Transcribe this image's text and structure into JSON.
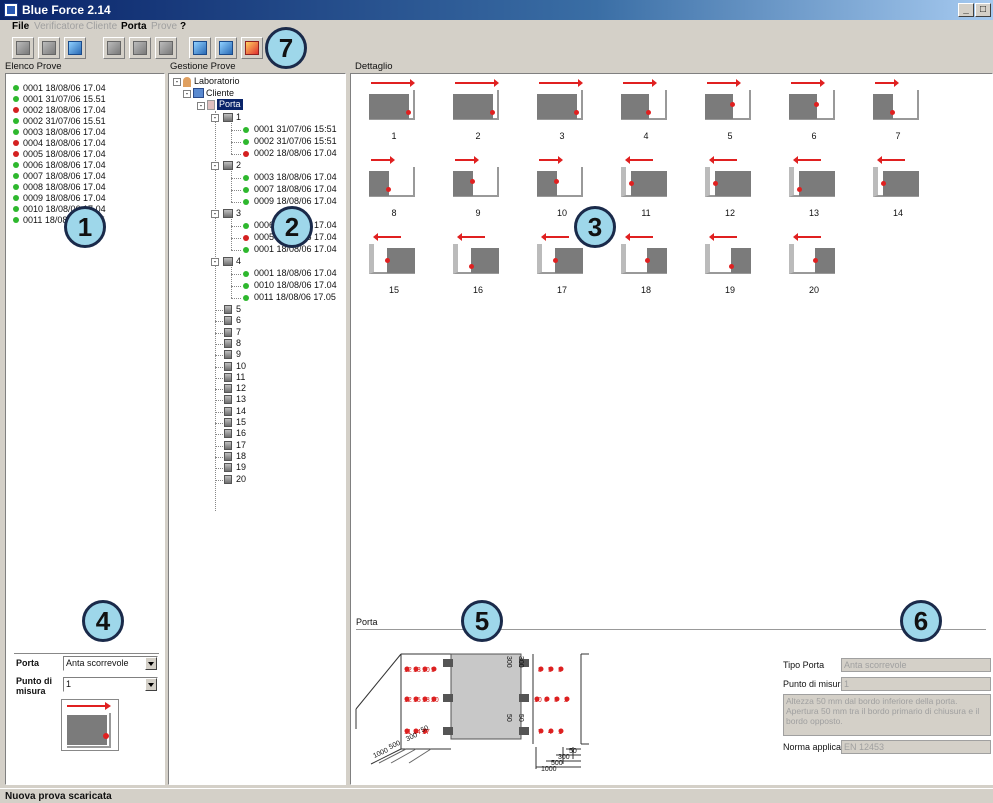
{
  "window": {
    "title": "Blue Force 2.14"
  },
  "menu": [
    {
      "label": "File",
      "enabled": true
    },
    {
      "label": "Verificatore",
      "enabled": false
    },
    {
      "label": "Cliente",
      "enabled": false
    },
    {
      "label": "Porta",
      "enabled": true
    },
    {
      "label": "Prove",
      "enabled": false
    },
    {
      "label": "?",
      "enabled": true
    }
  ],
  "toolbar": [
    {
      "icon": "open-test-icon"
    },
    {
      "icon": "save-test-icon"
    },
    {
      "icon": "export-icon"
    },
    {
      "icon": "tool-a-icon"
    },
    {
      "icon": "tool-b-icon"
    },
    {
      "icon": "tool-c-icon"
    },
    {
      "icon": "door-icon"
    },
    {
      "icon": "door-color-icon"
    },
    {
      "icon": "delete-icon"
    }
  ],
  "panels": {
    "elenco_title": "Elenco Prove",
    "gestione_title": "Gestione Prove",
    "dettaglio_title": "Dettaglio",
    "porta_title": "Porta"
  },
  "colors": {
    "ok": "#2eb82e",
    "fail": "#d42020",
    "accent": "#0a246a"
  },
  "elenco": [
    {
      "text": "0001 18/08/06 17.04",
      "status": "ok"
    },
    {
      "text": "0001 31/07/06 15.51",
      "status": "ok"
    },
    {
      "text": "0002 18/08/06 17.04",
      "status": "fail"
    },
    {
      "text": "0002 31/07/06 15.51",
      "status": "ok"
    },
    {
      "text": "0003 18/08/06 17.04",
      "status": "ok"
    },
    {
      "text": "0004 18/08/06 17.04",
      "status": "fail"
    },
    {
      "text": "0005 18/08/06 17.04",
      "status": "fail"
    },
    {
      "text": "0006 18/08/06 17.04",
      "status": "ok"
    },
    {
      "text": "0007 18/08/06 17.04",
      "status": "ok"
    },
    {
      "text": "0008 18/08/06 17.04",
      "status": "ok"
    },
    {
      "text": "0009 18/08/06 17.04",
      "status": "ok"
    },
    {
      "text": "0010 18/08/06 17.04",
      "status": "ok"
    },
    {
      "text": "0011 18/08/06 17.05",
      "status": "ok"
    }
  ],
  "tree": {
    "laboratorio": "Laboratorio",
    "cliente": "Cliente",
    "porta": "Porta",
    "groups": [
      {
        "label": "1",
        "items": [
          {
            "text": "0001 31/07/06 15:51",
            "status": "ok"
          },
          {
            "text": "0002 31/07/06 15:51",
            "status": "ok"
          },
          {
            "text": "0002 18/08/06 17.04",
            "status": "fail"
          }
        ]
      },
      {
        "label": "2",
        "items": [
          {
            "text": "0003 18/08/06 17.04",
            "status": "ok"
          },
          {
            "text": "0007 18/08/06 17.04",
            "status": "ok"
          },
          {
            "text": "0009 18/08/06 17.04",
            "status": "ok"
          }
        ]
      },
      {
        "label": "3",
        "items": [
          {
            "text": "0006 18/08/06 17.04",
            "status": "ok"
          },
          {
            "text": "0005 18/08/06 17.04",
            "status": "fail"
          },
          {
            "text": "0001 18/08/06 17.04",
            "status": "ok"
          }
        ]
      },
      {
        "label": "4",
        "items": [
          {
            "text": "0001 18/08/06 17.04",
            "status": "ok"
          },
          {
            "text": "0010 18/08/06 17.04",
            "status": "ok"
          },
          {
            "text": "0011 18/08/06 17.05",
            "status": "ok"
          }
        ]
      }
    ],
    "more": [
      "5",
      "6",
      "7",
      "8",
      "9",
      "10",
      "11",
      "12",
      "13",
      "14",
      "15",
      "16",
      "17",
      "18",
      "19",
      "20"
    ]
  },
  "dettaglio_positions": [
    "1",
    "2",
    "3",
    "4",
    "5",
    "6",
    "7",
    "8",
    "9",
    "10",
    "11",
    "12",
    "13",
    "14",
    "15",
    "16",
    "17",
    "18",
    "19",
    "20"
  ],
  "porta_field": {
    "label": "Porta",
    "value": "Anta scorrevole"
  },
  "punto_field": {
    "label_line1": "Punto di",
    "label_line2": "misura",
    "value": "1"
  },
  "info": {
    "tipo_label": "Tipo Porta",
    "tipo_value": "Anta scorrevole",
    "punto_label": "Punto di misura",
    "punto_value": "1",
    "desc": "Altezza 50 mm dal bordo inferiore della porta. Apertura 50 mm tra il bordo primario di chiusura e il bordo opposto.",
    "norma_label": "Norma applicata:",
    "norma_value": "EN 12453"
  },
  "diagram": {
    "left_labels": [
      "12",
      "13",
      "10",
      "9"
    ],
    "left_labels2": [
      "12",
      "15",
      "18",
      "20"
    ],
    "left_labels3": [
      "11",
      "14",
      "17"
    ],
    "right_labels": [
      "8",
      "5",
      "3"
    ],
    "right_labels2": [
      "10",
      "6",
      "3",
      "2"
    ],
    "right_labels3": [
      "7",
      "4",
      "1"
    ],
    "center_left_dims": [
      "300",
      "50"
    ],
    "center_right_dims": [
      "300",
      "50"
    ],
    "right_dims": [
      "50",
      "300",
      "500",
      "1000"
    ],
    "floor_dims": [
      "50",
      "300",
      "500",
      "1000"
    ]
  },
  "callouts": [
    "1",
    "2",
    "3",
    "4",
    "5",
    "6",
    "7"
  ],
  "status": "Nuova prova scaricata"
}
